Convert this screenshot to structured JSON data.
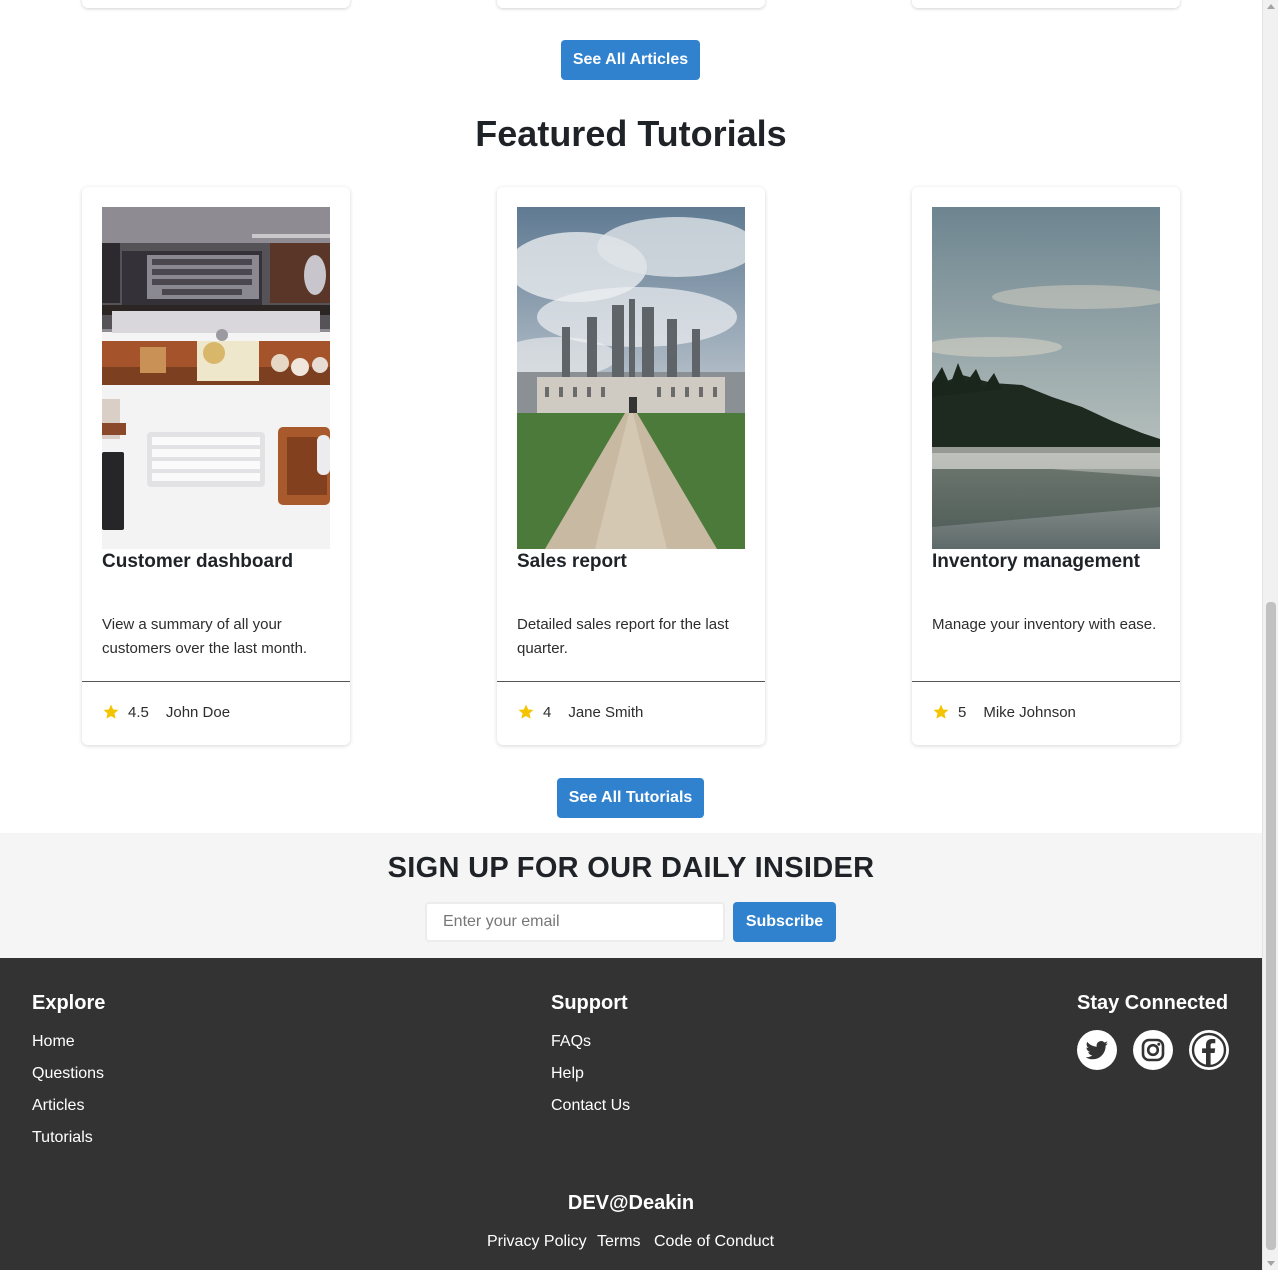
{
  "articles": {
    "see_all_label": "See All Articles"
  },
  "tutorials": {
    "title": "Featured Tutorials",
    "see_all_label": "See All Tutorials",
    "cards": [
      {
        "title": "Customer dashboard",
        "description": "View a summary of all your customers over the last month.",
        "rating": "4.5",
        "author": "John Doe",
        "image": "desk-workspace-image"
      },
      {
        "title": "Sales report",
        "description": "Detailed sales report for the last quarter.",
        "rating": "4",
        "author": "Jane Smith",
        "image": "castle-image"
      },
      {
        "title": "Inventory management",
        "description": "Manage your inventory with ease.",
        "rating": "5",
        "author": "Mike Johnson",
        "image": "misty-lake-image"
      }
    ]
  },
  "newsletter": {
    "title": "SIGN UP FOR OUR DAILY INSIDER",
    "email_placeholder": "Enter your email",
    "subscribe_label": "Subscribe"
  },
  "footer": {
    "explore": {
      "title": "Explore",
      "links": [
        "Home",
        "Questions",
        "Articles",
        "Tutorials"
      ]
    },
    "support": {
      "title": "Support",
      "links": [
        "FAQs",
        "Help",
        "Contact Us"
      ]
    },
    "connect": {
      "title": "Stay Connected",
      "icons": [
        "twitter-icon",
        "instagram-icon",
        "facebook-icon"
      ]
    },
    "brand": "DEV@Deakin",
    "legal": [
      "Privacy Policy",
      "Terms",
      "Code of Conduct"
    ]
  },
  "colors": {
    "accent": "#3182ce",
    "footer_bg": "#333333",
    "newsletter_bg": "#f5f5f5",
    "star": "#f5c400"
  }
}
